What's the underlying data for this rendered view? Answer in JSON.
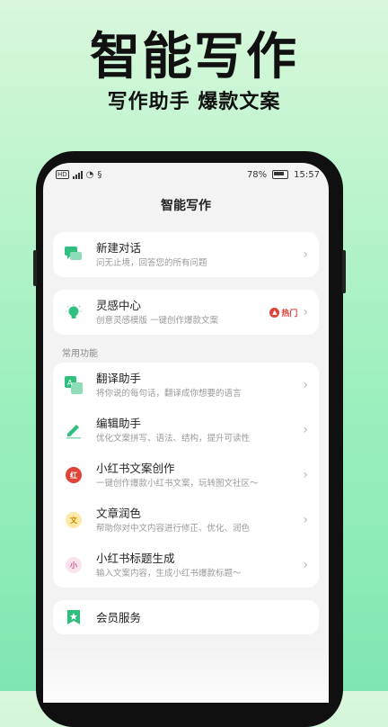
{
  "promo": {
    "title": "智能写作",
    "subtitle": "写作助手  爆款文案"
  },
  "status": {
    "battery_pct": "78%",
    "time": "15:57"
  },
  "header": {
    "title": "智能写作"
  },
  "cards": {
    "new_chat": {
      "title": "新建对话",
      "desc": "问无止境，回答您的所有问题",
      "icon": "chat-bubble-icon"
    },
    "inspiration": {
      "title": "灵感中心",
      "desc": "创意灵感模版 一键创作爆款文案",
      "badge": "热门",
      "icon": "lightbulb-icon"
    }
  },
  "section": {
    "label": "常用功能"
  },
  "features": [
    {
      "title": "翻译助手",
      "desc": "将你说的每句话，翻译成你想要的语言",
      "icon": "translate-icon",
      "color": "#2fbf7f"
    },
    {
      "title": "编辑助手",
      "desc": "优化文案拼写、语法、结构，提升可读性",
      "icon": "edit-pen-icon",
      "color": "#2fbf7f"
    },
    {
      "title": "小红书文案创作",
      "desc": "一键创作爆款小红书文案，玩转图文社区～",
      "icon": "xiaohongshu-icon",
      "glyph": "红",
      "color": "#e0433a"
    },
    {
      "title": "文章润色",
      "desc": "帮助你对中文内容进行修正、优化、润色",
      "icon": "article-icon",
      "glyph": "文",
      "color": "#e6a800"
    },
    {
      "title": "小红书标题生成",
      "desc": "输入文案内容，生成小红书爆款标题～",
      "icon": "title-icon",
      "glyph": "小",
      "color": "#c4578f"
    }
  ],
  "member": {
    "title": "会员服务",
    "icon": "member-bookmark-icon"
  },
  "colors": {
    "accent": "#2fbf7f",
    "hot": "#e0433a"
  }
}
